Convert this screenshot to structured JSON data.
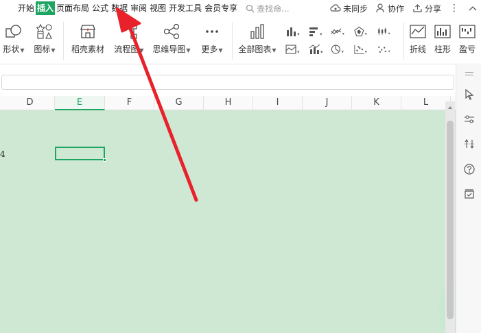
{
  "menu": {
    "items": [
      "开始",
      "插入",
      "页面布局",
      "公式",
      "数据",
      "审阅",
      "视图",
      "开发工具",
      "会员专享"
    ],
    "active_index": 1,
    "search_placeholder": "查找命...",
    "unsynced": "未同步",
    "collaborate": "协作",
    "share": "分享"
  },
  "ribbon": {
    "shape": "形状",
    "icon": "图标",
    "material": "稻壳素材",
    "flowchart": "流程图",
    "mindmap": "思维导图",
    "more": "更多",
    "all_charts": "全部图表",
    "line": "折线",
    "column": "柱形",
    "profit_loss": "盈亏"
  },
  "columns": [
    "D",
    "E",
    "F",
    "G",
    "H",
    "I",
    "J",
    "K",
    "L"
  ],
  "selected_column": "E",
  "row_label": "4",
  "colors": {
    "accent": "#1fa562",
    "sheet_bg": "#cfe8d3",
    "arrow": "#e8212b"
  }
}
